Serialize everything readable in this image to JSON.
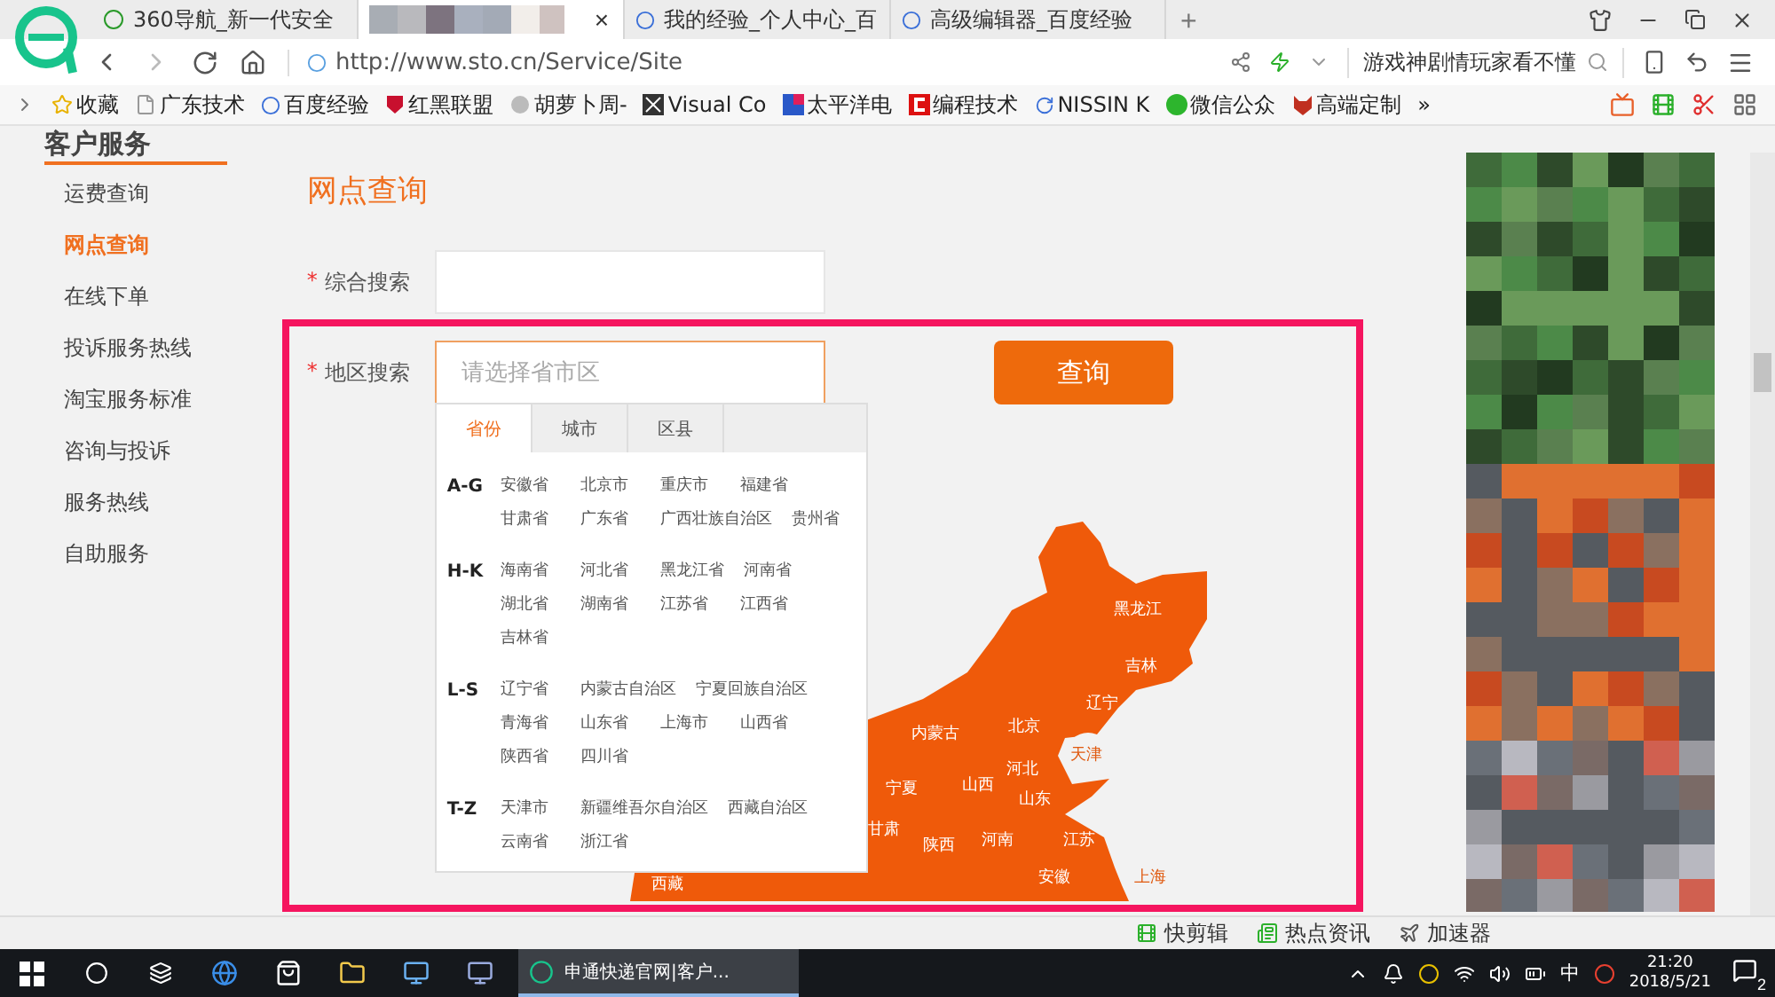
{
  "browser": {
    "tabs": [
      {
        "label": "360导航_新一代安全",
        "selected": false
      },
      {
        "selected": true,
        "close": "×"
      },
      {
        "label": "我的经验_个人中心_百",
        "selected": false
      },
      {
        "label": "高级编辑器_百度经验",
        "selected": false
      }
    ],
    "new_tab": "+",
    "address": "http://www.sto.cn/Service/Site",
    "search": "游戏神剧情玩家看不懂",
    "bookmarks": [
      {
        "label": "收藏"
      },
      {
        "label": "广东技术"
      },
      {
        "label": "百度经验"
      },
      {
        "label": "红黑联盟"
      },
      {
        "label": "胡萝卜周-"
      },
      {
        "label": "Visual Co"
      },
      {
        "label": "太平洋电"
      },
      {
        "label": "编程技术"
      },
      {
        "label": "NISSIN K"
      },
      {
        "label": "微信公众"
      },
      {
        "label": "高端定制"
      }
    ],
    "more": "»"
  },
  "sidebar": {
    "heading": "客户服务",
    "items": [
      {
        "label": "运费查询",
        "selected": false
      },
      {
        "label": "网点查询",
        "selected": true
      },
      {
        "label": "在线下单",
        "selected": false
      },
      {
        "label": "投诉服务热线",
        "selected": false
      },
      {
        "label": "淘宝服务标准",
        "selected": false
      },
      {
        "label": "咨询与投诉",
        "selected": false
      },
      {
        "label": "服务热线",
        "selected": false
      },
      {
        "label": "自助服务",
        "selected": false
      }
    ]
  },
  "main": {
    "title": "网点查询",
    "fields": [
      {
        "label": "综合搜索",
        "marker": "*",
        "focused": false
      },
      {
        "label": "地区搜索",
        "marker": "*",
        "focused": true,
        "placeholder": "请选择省市区"
      }
    ],
    "button": "查询",
    "picker": {
      "tabs": [
        {
          "label": "省份",
          "selected": true
        },
        {
          "label": "城市",
          "selected": false
        },
        {
          "label": "区县",
          "selected": false
        }
      ],
      "groups": [
        {
          "range": "A-G",
          "items": [
            "安徽省",
            "北京市",
            "重庆市",
            "福建省",
            "甘肃省",
            "广东省",
            "广西壮族自治区",
            "贵州省"
          ]
        },
        {
          "range": "H-K",
          "items": [
            "海南省",
            "河北省",
            "黑龙江省",
            "河南省",
            "湖北省",
            "湖南省",
            "江苏省",
            "江西省",
            "吉林省"
          ]
        },
        {
          "range": "L-S",
          "items": [
            "辽宁省",
            "内蒙古自治区",
            "宁夏回族自治区",
            "青海省",
            "山东省",
            "上海市",
            "山西省",
            "陕西省",
            "四川省"
          ]
        },
        {
          "range": "T-Z",
          "items": [
            "天津市",
            "新疆维吾尔自治区",
            "西藏自治区",
            "云南省",
            "浙江省"
          ]
        }
      ]
    },
    "map_labels": [
      "黑龙江",
      "吉林",
      "辽宁",
      "内蒙古",
      "北京",
      "天津",
      "河北",
      "宁夏",
      "山西",
      "山东",
      "甘肃",
      "陕西",
      "河南",
      "江苏",
      "安徽",
      "上海",
      "西藏"
    ]
  },
  "status_bar": {
    "items": [
      "快剪辑",
      "热点资讯",
      "加速器"
    ]
  },
  "taskbar": {
    "app": "申通快递官网|客户...",
    "ime": "中",
    "time": "21:20",
    "date": "2018/5/21",
    "notifications": "2"
  }
}
